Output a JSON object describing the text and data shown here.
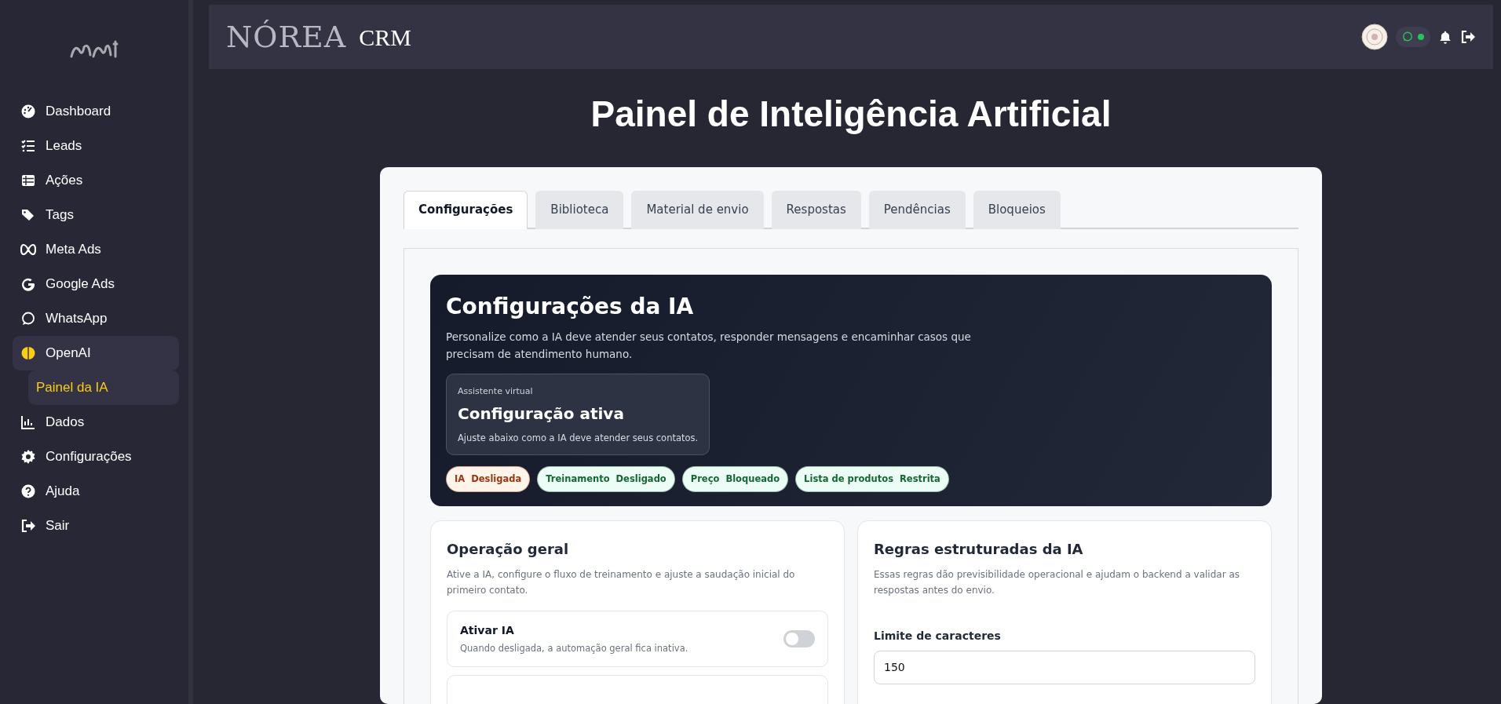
{
  "sidebar": {
    "items": [
      {
        "label": "Dashboard",
        "selected": false
      },
      {
        "label": "Leads",
        "selected": false
      },
      {
        "label": "Ações",
        "selected": false
      },
      {
        "label": "Tags",
        "selected": false
      },
      {
        "label": "Meta Ads",
        "selected": false
      },
      {
        "label": "Google Ads",
        "selected": false
      },
      {
        "label": "WhatsApp",
        "selected": false
      },
      {
        "label": "OpenAI",
        "selected": false,
        "expanded": true,
        "children": [
          {
            "label": "Painel da IA",
            "selected": true
          }
        ]
      },
      {
        "label": "Dados",
        "selected": false
      },
      {
        "label": "Configurações",
        "selected": false
      },
      {
        "label": "Ajuda",
        "selected": false
      },
      {
        "label": "Sair",
        "selected": false
      }
    ]
  },
  "header": {
    "brand": "NÓREA",
    "brand_suffix": "CRM",
    "whatsapp_connected": true
  },
  "page_title": "Painel de Inteligência Artificial",
  "tabs": [
    {
      "label": "Configurações",
      "selected": true
    },
    {
      "label": "Biblioteca",
      "selected": false
    },
    {
      "label": "Material de envio",
      "selected": false
    },
    {
      "label": "Respostas",
      "selected": false
    },
    {
      "label": "Pendências",
      "selected": false
    },
    {
      "label": "Bloqueios",
      "selected": false
    }
  ],
  "hero": {
    "title": "Configurações da IA",
    "description": "Personalize como a IA deve atender seus contatos, responder mensagens e encaminhar casos que precisam de atendimento humano.",
    "status_card": {
      "eyebrow": "Assistente virtual",
      "title": "Configuração ativa",
      "text": "Ajuste abaixo como a IA deve atender seus contatos."
    },
    "badges": [
      {
        "label": "IA",
        "value": "Desligada",
        "color": "#9a3412"
      },
      {
        "label": "Treinamento",
        "value": "Desligado",
        "color": "#166534"
      },
      {
        "label": "Preço",
        "value": "Bloqueado",
        "color": "#166534"
      },
      {
        "label": "Lista de produtos",
        "value": "Restrita",
        "color": "#166534"
      }
    ]
  },
  "general": {
    "title": "Operação geral",
    "description": "Ative a IA, configure o fluxo de treinamento e ajuste a saudação inicial do primeiro contato.",
    "settings": [
      {
        "title": "Ativar IA",
        "text": "Quando desligada, a automação geral fica inativa.",
        "on": false
      }
    ]
  },
  "rules": {
    "title": "Regras estruturadas da IA",
    "description": "Essas regras dão previsibilidade operacional e ajudam o backend a validar as respostas antes do envio.",
    "fields": [
      {
        "label": "Limite de caracteres",
        "value": "150"
      }
    ]
  }
}
